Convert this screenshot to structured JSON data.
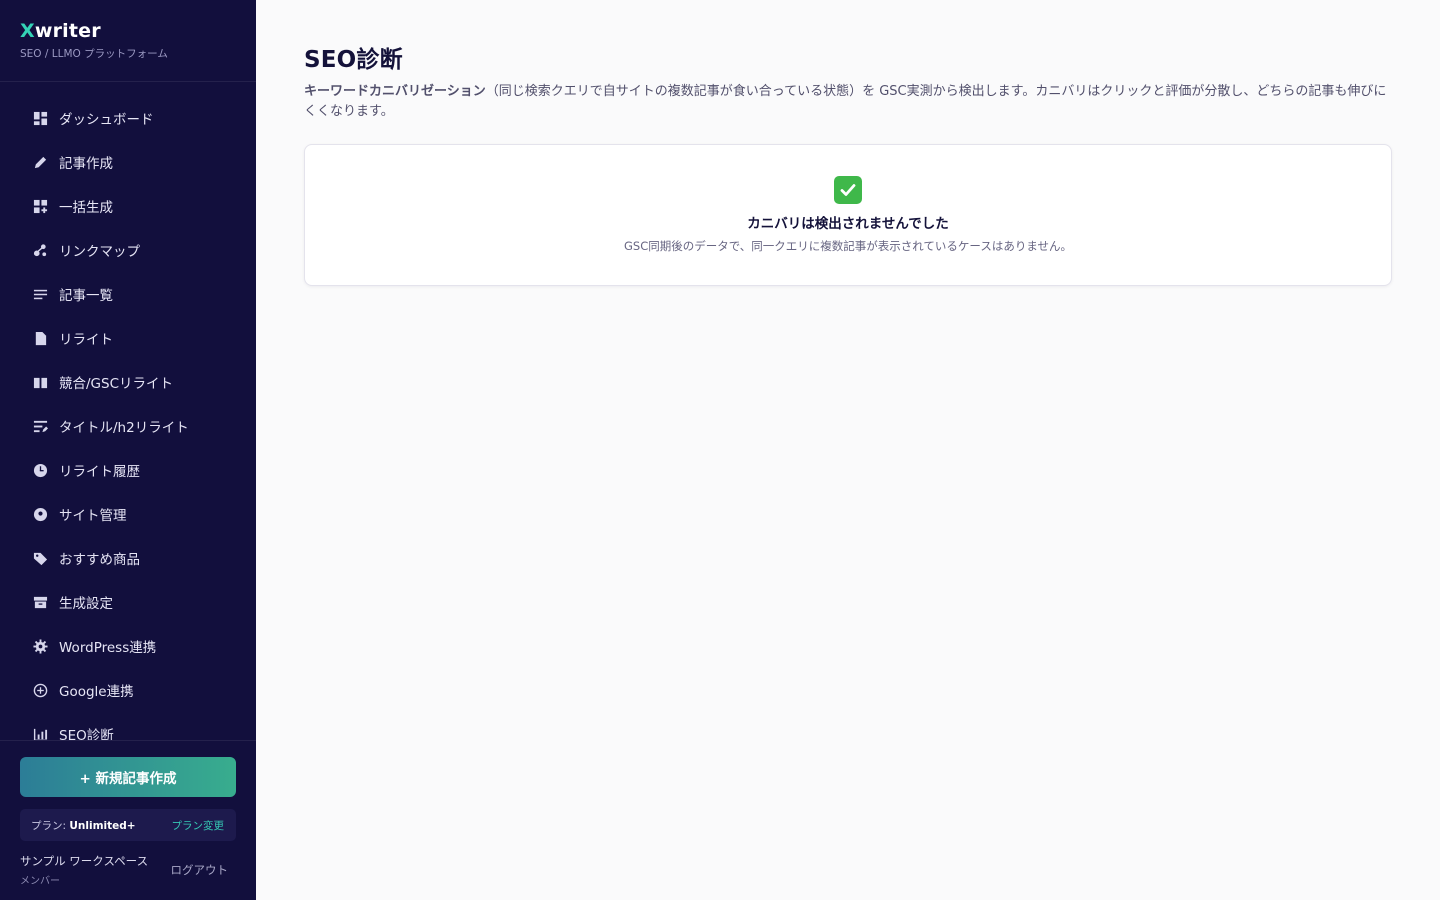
{
  "brand": {
    "accent_letter": "X",
    "rest": "writer",
    "subtitle": "SEO / LLMO プラットフォーム"
  },
  "sidebar": {
    "items": [
      {
        "label": "ダッシュボード",
        "icon": "dashboard-icon"
      },
      {
        "label": "記事作成",
        "icon": "pencil-icon"
      },
      {
        "label": "一括生成",
        "icon": "grid-add-icon"
      },
      {
        "label": "リンクマップ",
        "icon": "link-map-icon"
      },
      {
        "label": "記事一覧",
        "icon": "list-icon"
      },
      {
        "label": "リライト",
        "icon": "document-edit-icon"
      },
      {
        "label": "競合/GSCリライト",
        "icon": "book-icon"
      },
      {
        "label": "タイトル/h2リライト",
        "icon": "title-edit-icon"
      },
      {
        "label": "リライト履歴",
        "icon": "clock-icon"
      },
      {
        "label": "サイト管理",
        "icon": "site-pin-icon"
      },
      {
        "label": "おすすめ商品",
        "icon": "tag-icon"
      },
      {
        "label": "生成設定",
        "icon": "archive-icon"
      },
      {
        "label": "WordPress連携",
        "icon": "gear-icon"
      },
      {
        "label": "Google連携",
        "icon": "plus-circle-icon"
      },
      {
        "label": "SEO診断",
        "icon": "chart-icon"
      }
    ],
    "new_article_button": "+ 新規記事作成",
    "plan_label": "プラン:",
    "plan_value": "Unlimited+",
    "plan_change": "プラン変更",
    "workspace_name": "サンプル ワークスペース",
    "workspace_role": "メンバー",
    "logout": "ログアウト"
  },
  "main": {
    "title": "SEO診断",
    "desc_keyword": "キーワードカニバリゼーション",
    "desc_rest": "（同じ検索クエリで自サイトの複数記事が食い合っている状態）を GSC実測から検出します。カニバリはクリックと評価が分散し、どちらの記事も伸びにくくなります。",
    "empty_title": "カニバリは検出されませんでした",
    "empty_sub": "GSC同期後のデータで、同一クエリに複数記事が表示されているケースはありません。"
  },
  "colors": {
    "sidebar_bg": "#120f3d",
    "accent": "#34d3b6",
    "button_from": "#2c7d97",
    "button_to": "#38ad8e",
    "check": "#3fb84a"
  }
}
